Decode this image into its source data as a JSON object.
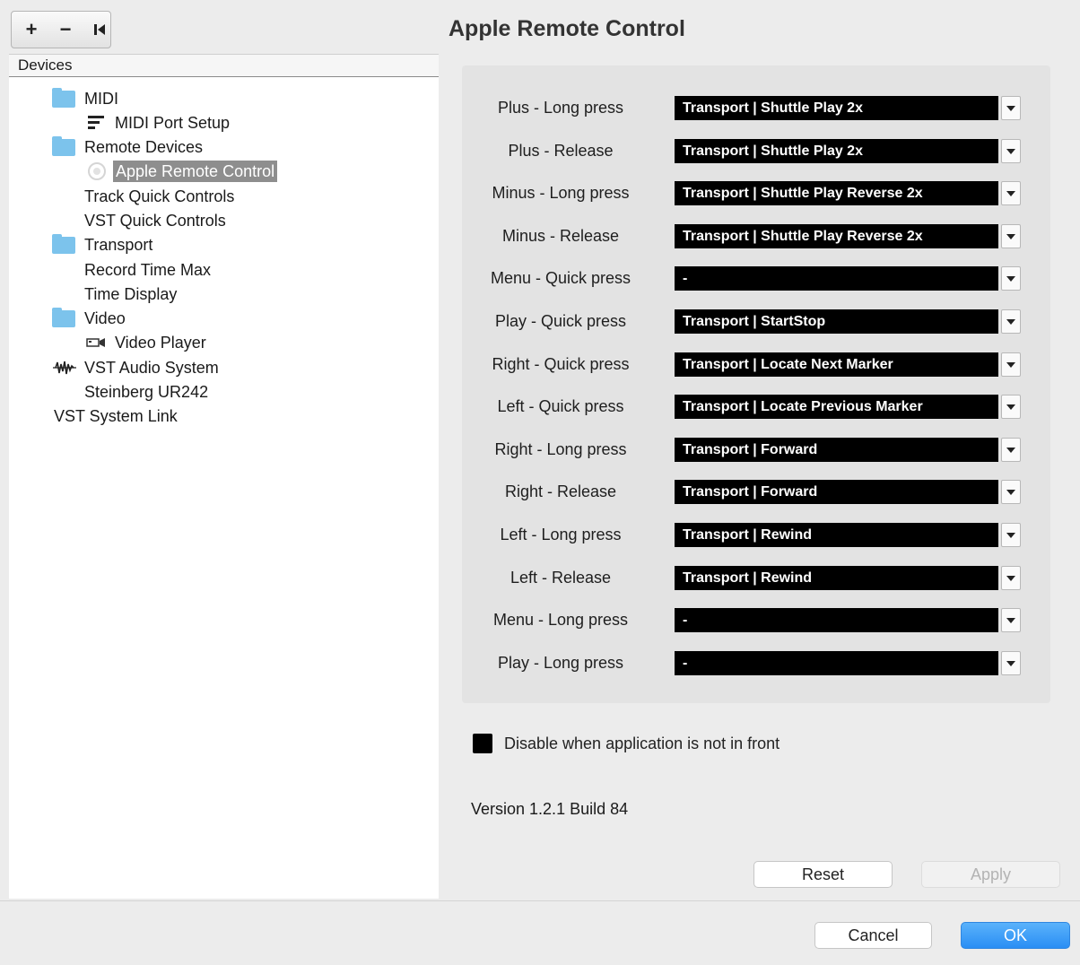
{
  "toolbar": {
    "add_label": "+",
    "remove_label": "−"
  },
  "devices": {
    "header": "Devices",
    "items": [
      {
        "label": "MIDI",
        "icon": "folder-icon"
      },
      {
        "label": "MIDI Port Setup",
        "icon": "midi-port-icon"
      },
      {
        "label": "Remote Devices",
        "icon": "folder-icon"
      },
      {
        "label": "Apple Remote Control",
        "icon": "apple-remote-icon",
        "selected": true
      },
      {
        "label": "Track Quick Controls",
        "icon": ""
      },
      {
        "label": "VST Quick Controls",
        "icon": ""
      },
      {
        "label": "Transport",
        "icon": "folder-icon"
      },
      {
        "label": "Record Time Max",
        "icon": ""
      },
      {
        "label": "Time Display",
        "icon": ""
      },
      {
        "label": "Video",
        "icon": "folder-icon"
      },
      {
        "label": "Video Player",
        "icon": "video-player-icon"
      },
      {
        "label": "VST Audio System",
        "icon": "audio-system-icon"
      },
      {
        "label": "Steinberg UR242",
        "icon": ""
      },
      {
        "label": "VST System Link",
        "icon": ""
      }
    ]
  },
  "panel": {
    "title": "Apple Remote Control",
    "mappings": [
      {
        "label": "Plus - Long press",
        "value": "Transport | Shuttle Play 2x"
      },
      {
        "label": "Plus - Release",
        "value": "Transport | Shuttle Play 2x"
      },
      {
        "label": "Minus - Long press",
        "value": "Transport | Shuttle Play Reverse 2x"
      },
      {
        "label": "Minus - Release",
        "value": "Transport | Shuttle Play Reverse 2x"
      },
      {
        "label": "Menu - Quick press",
        "value": "-"
      },
      {
        "label": "Play - Quick press",
        "value": "Transport | StartStop"
      },
      {
        "label": "Right - Quick press",
        "value": "Transport | Locate Next Marker"
      },
      {
        "label": "Left - Quick press",
        "value": "Transport | Locate Previous Marker"
      },
      {
        "label": "Right - Long press",
        "value": "Transport | Forward"
      },
      {
        "label": "Right - Release",
        "value": "Transport | Forward"
      },
      {
        "label": "Left - Long press",
        "value": "Transport | Rewind"
      },
      {
        "label": "Left - Release",
        "value": "Transport | Rewind"
      },
      {
        "label": "Menu - Long press",
        "value": "-"
      },
      {
        "label": "Play - Long press",
        "value": "-"
      }
    ],
    "disable_checkbox": {
      "label": "Disable when application is not in front",
      "checked": true
    },
    "version": "Version 1.2.1 Build 84",
    "reset_label": "Reset",
    "apply_label": "Apply"
  },
  "footer": {
    "cancel_label": "Cancel",
    "ok_label": "OK"
  }
}
